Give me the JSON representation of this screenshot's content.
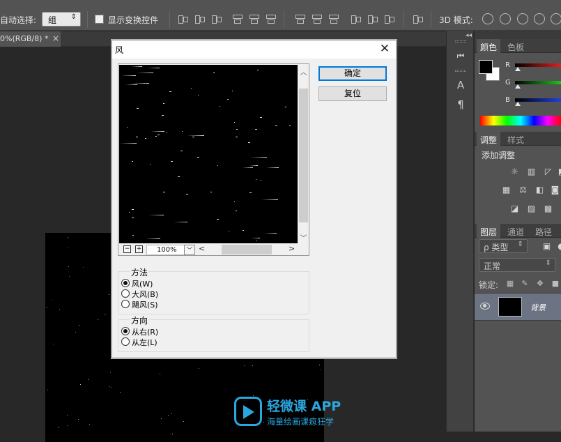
{
  "options_bar": {
    "auto_select_label": "自动选择:",
    "auto_select_value": "组",
    "show_transform_label": "显示变换控件",
    "mode_3d_label": "3D 模式:"
  },
  "document_tab": {
    "title": "0%(RGB/8) *",
    "close": "×"
  },
  "dock": {
    "type_tool_glyph": "A",
    "paragraph_glyph": "¶"
  },
  "color_panel": {
    "tabs": [
      "颜色",
      "色板"
    ],
    "sliders": [
      {
        "label": "R",
        "color": "#e02020"
      },
      {
        "label": "G",
        "color": "#20c020"
      },
      {
        "label": "B",
        "color": "#2040e0"
      }
    ],
    "foreground": "#000000",
    "background": "#ffffff"
  },
  "adjustments_panel": {
    "tabs": [
      "调整",
      "样式"
    ],
    "heading": "添加调整"
  },
  "layers_panel": {
    "tabs": [
      "图层",
      "通道",
      "路径"
    ],
    "kind_filter": "ρ 类型",
    "blend_mode": "正常",
    "lock_label": "锁定:",
    "layer_name": "背景"
  },
  "dialog": {
    "title": "风",
    "close": "✕",
    "zoom_level": "100%",
    "ok_label": "确定",
    "reset_label": "复位",
    "method": {
      "legend": "方法",
      "options": [
        "风(W)",
        "大风(B)",
        "飓风(S)"
      ],
      "selected": 0
    },
    "direction": {
      "legend": "方向",
      "options": [
        "从右(R)",
        "从左(L)"
      ],
      "selected": 0
    }
  },
  "watermark": {
    "title": "轻微课 APP",
    "subtitle": "海量绘画课疯狂学",
    "color": "#2aa7e0"
  }
}
